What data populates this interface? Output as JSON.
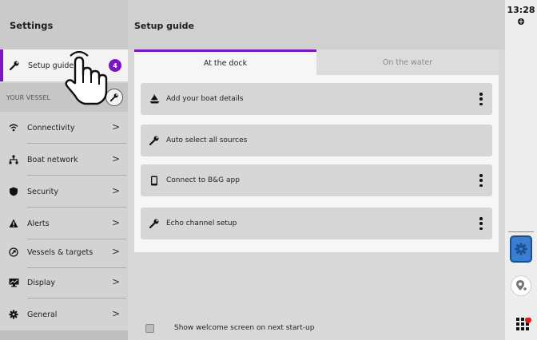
{
  "sidebar": {
    "title": "Settings",
    "active_item": {
      "label": "Setup guide",
      "badge": "4"
    },
    "section_label": "YOUR VESSEL",
    "items": [
      {
        "label": "Connectivity"
      },
      {
        "label": "Boat network"
      },
      {
        "label": "Security"
      },
      {
        "label": "Alerts"
      },
      {
        "label": "Vessels & targets"
      },
      {
        "label": "Display"
      },
      {
        "label": "General"
      }
    ],
    "chevron": ">"
  },
  "main": {
    "title": "Setup guide",
    "tabs": [
      {
        "label": "At the dock",
        "active": true
      },
      {
        "label": "On the water",
        "active": false
      }
    ],
    "rows": [
      {
        "label": "Add your boat details",
        "icon": "boat-icon",
        "has_menu": true
      },
      {
        "label": "Auto select all sources",
        "icon": "wrench-icon",
        "has_menu": false
      },
      {
        "label": "Connect to B&G app",
        "icon": "phone-icon",
        "has_menu": true
      },
      {
        "label": "Echo channel setup",
        "icon": "wrench-icon",
        "has_menu": true
      }
    ],
    "footer_checkbox_label": "Show welcome screen on next start-up"
  },
  "statusbar": {
    "time": "13:28"
  },
  "colors": {
    "accent": "#7a17c2",
    "blue_button": "#3a7ed1"
  }
}
